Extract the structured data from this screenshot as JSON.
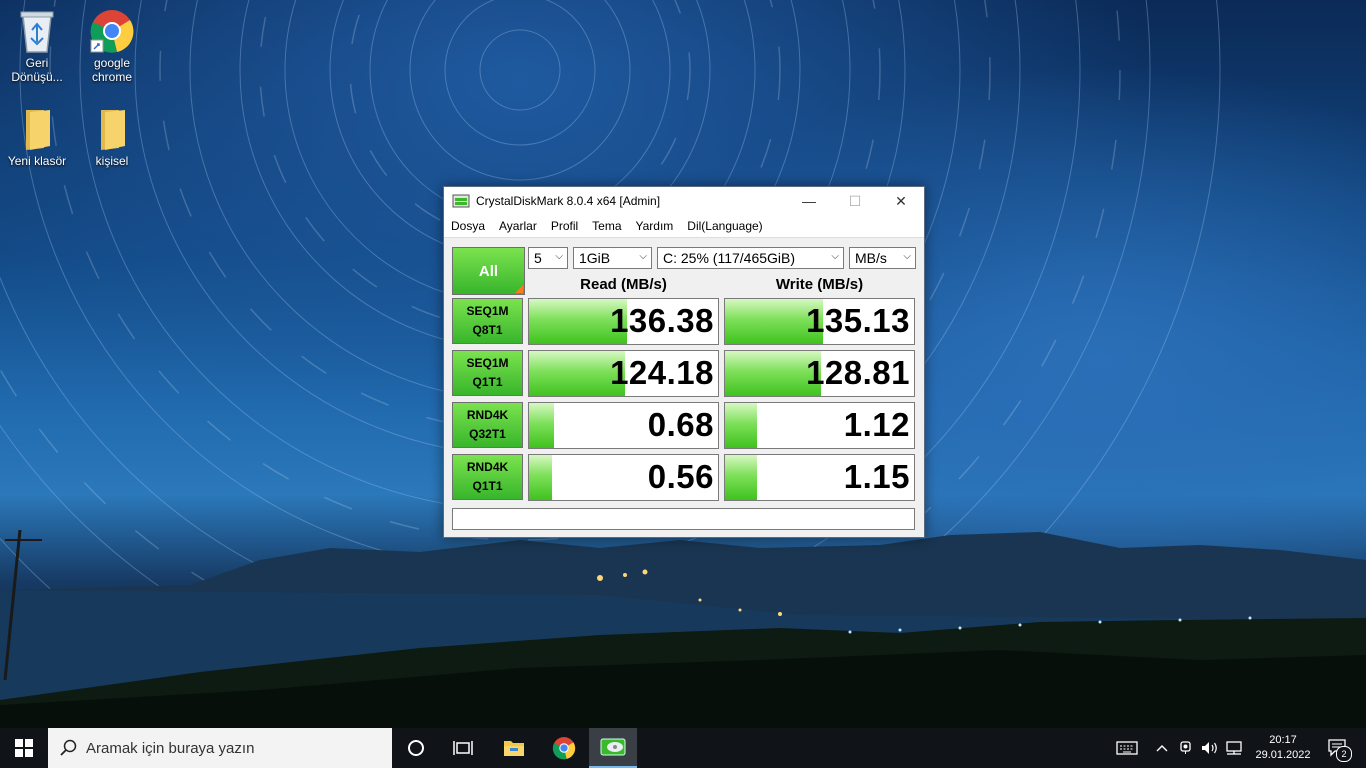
{
  "desktop": {
    "icons": [
      {
        "label": "Geri Dönüşü...",
        "icon": "recycle-bin-icon"
      },
      {
        "label": "google chrome",
        "icon": "chrome-icon"
      },
      {
        "label": "Yeni klasör",
        "icon": "folder-icon"
      },
      {
        "label": "kişisel",
        "icon": "folder-icon"
      }
    ]
  },
  "window": {
    "title": "CrystalDiskMark 8.0.4 x64 [Admin]",
    "controls": {
      "minimize": "—",
      "maximize": "☐",
      "close": "✕"
    },
    "menu": [
      "Dosya",
      "Ayarlar",
      "Profil",
      "Tema",
      "Yardım",
      "Dil(Language)"
    ]
  },
  "cdm": {
    "all_label": "All",
    "count": "5",
    "size": "1GiB",
    "drive": "C: 25% (117/465GiB)",
    "unit": "MB/s",
    "read_header": "Read (MB/s)",
    "write_header": "Write (MB/s)",
    "tests": [
      {
        "line1": "SEQ1M",
        "line2": "Q8T1",
        "read": "136.38",
        "write": "135.13",
        "read_fill": 0.52,
        "write_fill": 0.52
      },
      {
        "line1": "SEQ1M",
        "line2": "Q1T1",
        "read": "124.18",
        "write": "128.81",
        "read_fill": 0.51,
        "write_fill": 0.51
      },
      {
        "line1": "RND4K",
        "line2": "Q32T1",
        "read": "0.68",
        "write": "1.12",
        "read_fill": 0.13,
        "write_fill": 0.17
      },
      {
        "line1": "RND4K",
        "line2": "Q1T1",
        "read": "0.56",
        "write": "1.15",
        "read_fill": 0.12,
        "write_fill": 0.17
      }
    ],
    "comment": ""
  },
  "taskbar": {
    "search_placeholder": "Aramak için buraya yazın",
    "time": "20:17",
    "date": "29.01.2022",
    "notification_count": "2",
    "accent": "#0078d7"
  }
}
